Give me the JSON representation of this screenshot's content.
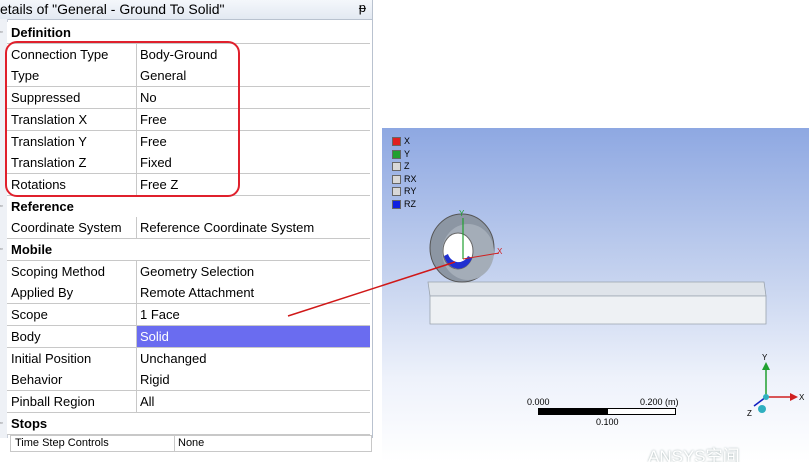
{
  "details": {
    "title": "etails of \"General - Ground To Solid\"",
    "pin_glyph": "ᵽ",
    "rows": [
      {
        "k": "Definition",
        "v": "",
        "type": "section"
      },
      {
        "k": "Connection Type",
        "v": "Body-Ground"
      },
      {
        "k": "Type",
        "v": "General"
      },
      {
        "k": "Suppressed",
        "v": "No"
      },
      {
        "k": "Translation X",
        "v": "Free"
      },
      {
        "k": "Translation Y",
        "v": "Free"
      },
      {
        "k": "Translation Z",
        "v": "Fixed"
      },
      {
        "k": "Rotations",
        "v": "Free Z"
      },
      {
        "k": "Reference",
        "v": "",
        "type": "section"
      },
      {
        "k": "Coordinate System",
        "v": "Reference Coordinate System"
      },
      {
        "k": "Mobile",
        "v": "",
        "type": "section"
      },
      {
        "k": "Scoping Method",
        "v": "Geometry Selection"
      },
      {
        "k": "Applied By",
        "v": "Remote Attachment"
      },
      {
        "k": "Scope",
        "v": "1 Face"
      },
      {
        "k": "Body",
        "v": "Solid",
        "selected": true
      },
      {
        "k": "Initial Position",
        "v": "Unchanged"
      },
      {
        "k": "Behavior",
        "v": "Rigid"
      },
      {
        "k": "Pinball Region",
        "v": "All"
      },
      {
        "k": "Stops",
        "v": "",
        "type": "section"
      }
    ],
    "extra_row": {
      "k": "Time Step Controls",
      "v": "None"
    }
  },
  "viewport": {
    "dof_legend": [
      {
        "label": "X",
        "color": "#e02020"
      },
      {
        "label": "Y",
        "color": "#20a030"
      },
      {
        "label": "Z",
        "color": "#d8d8d8"
      },
      {
        "label": "RX",
        "color": "#d8d8d8"
      },
      {
        "label": "RY",
        "color": "#d8d8d8"
      },
      {
        "label": "RZ",
        "color": "#1020e0"
      }
    ],
    "scale": {
      "left": "0.000",
      "right": "0.200 (m)",
      "mid": "0.100"
    },
    "triad_labels": {
      "x": "X",
      "y": "Y",
      "z": "Z"
    },
    "model_triad_labels": {
      "x": "X",
      "y": "Y"
    },
    "watermark": "ANSYS空间"
  }
}
